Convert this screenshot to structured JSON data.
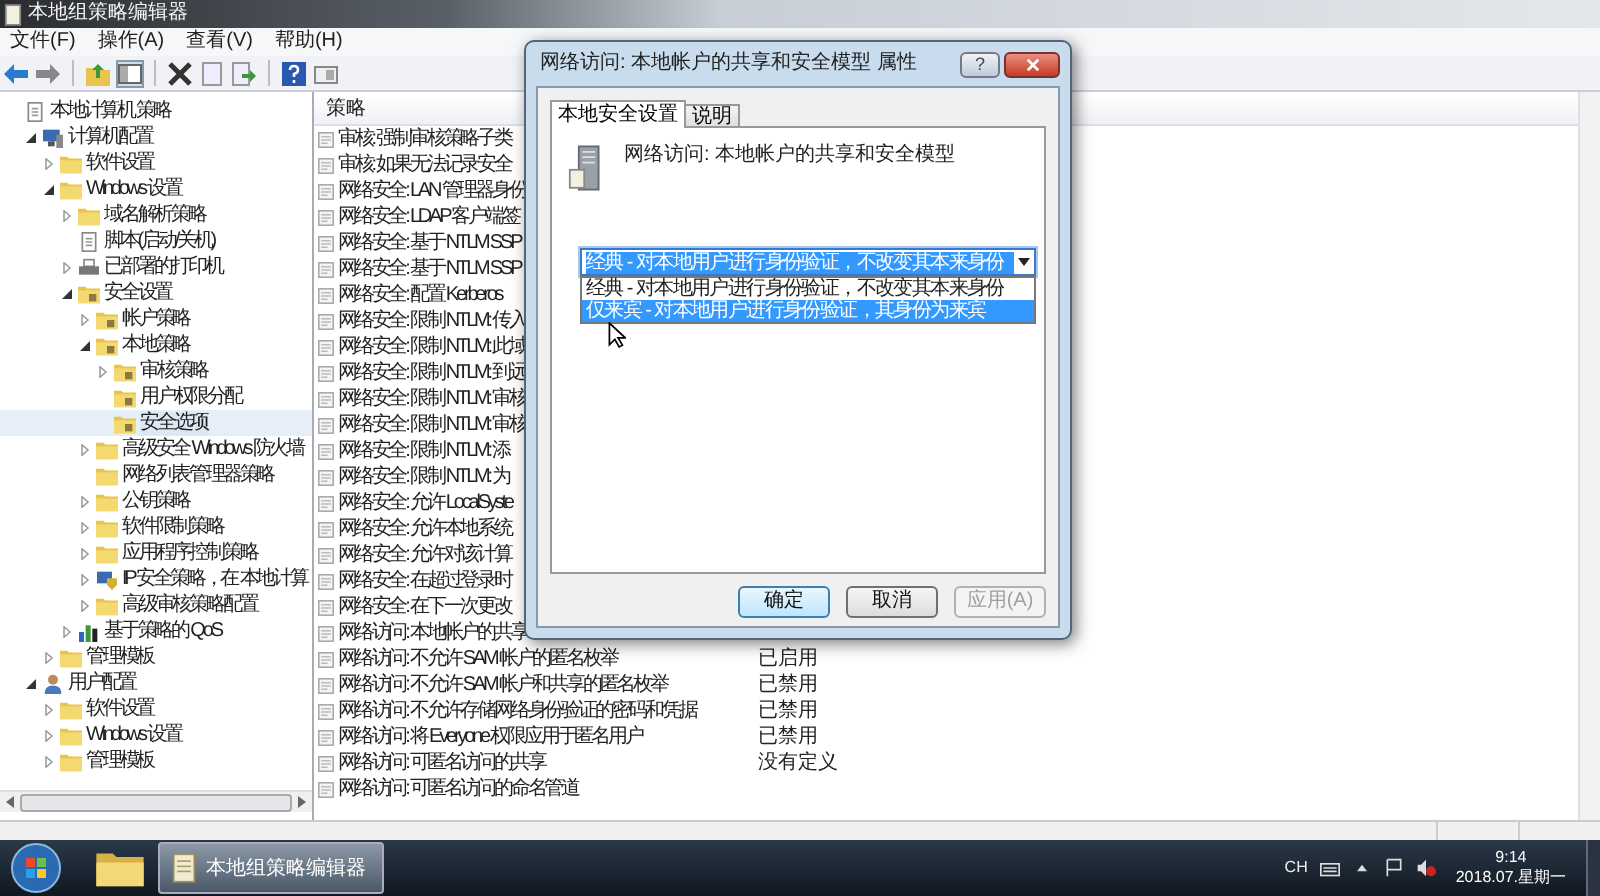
{
  "window": {
    "title": "本地组策略编辑器"
  },
  "menu": [
    "文件(F)",
    "操作(A)",
    "查看(V)",
    "帮助(H)"
  ],
  "tree": [
    {
      "label": "本地计算机 策略",
      "kind": "document",
      "selected": false,
      "children": [
        {
          "label": "计算机配置",
          "kind": "computer",
          "expanded": true,
          "selected": false,
          "children": [
            {
              "label": "软件设置",
              "kind": "folder",
              "expanded": false,
              "selected": false
            },
            {
              "label": "Windows 设置",
              "kind": "folder",
              "expanded": true,
              "selected": false,
              "children": [
                {
                  "label": "域名解析策略",
                  "kind": "folder",
                  "expanded": false,
                  "selected": false
                },
                {
                  "label": "脚本(启动/关机)",
                  "kind": "document",
                  "selected": false
                },
                {
                  "label": "已部署的打印机",
                  "kind": "printer",
                  "expanded": false,
                  "selected": false
                },
                {
                  "label": "安全设置",
                  "kind": "secure-folder",
                  "expanded": true,
                  "selected": false,
                  "children": [
                    {
                      "label": "帐户策略",
                      "kind": "secure-folder",
                      "expanded": false,
                      "selected": false
                    },
                    {
                      "label": "本地策略",
                      "kind": "secure-folder",
                      "expanded": true,
                      "selected": false,
                      "children": [
                        {
                          "label": "审核策略",
                          "kind": "secure-folder",
                          "expanded": false,
                          "selected": false
                        },
                        {
                          "label": "用户权限分配",
                          "kind": "secure-folder",
                          "selected": false
                        },
                        {
                          "label": "安全选项",
                          "kind": "secure-folder",
                          "selected": true
                        }
                      ]
                    },
                    {
                      "label": "高级安全 Windows 防火墙",
                      "kind": "folder",
                      "expanded": false,
                      "selected": false
                    },
                    {
                      "label": "网络列表管理器策略",
                      "kind": "folder",
                      "selected": false
                    },
                    {
                      "label": "公钥策略",
                      "kind": "folder",
                      "expanded": false,
                      "selected": false
                    },
                    {
                      "label": "软件限制策略",
                      "kind": "folder",
                      "expanded": false,
                      "selected": false
                    },
                    {
                      "label": "应用程序控制策略",
                      "kind": "folder",
                      "expanded": false,
                      "selected": false
                    },
                    {
                      "label": "IP 安全策略，在 本地计算",
                      "kind": "shield",
                      "expanded": false,
                      "selected": false
                    },
                    {
                      "label": "高级审核策略配置",
                      "kind": "folder",
                      "expanded": false,
                      "selected": false
                    }
                  ]
                },
                {
                  "label": "基于策略的 QoS",
                  "kind": "chart",
                  "expanded": false,
                  "selected": false
                }
              ]
            },
            {
              "label": "管理模板",
              "kind": "folder",
              "expanded": false,
              "selected": false
            }
          ]
        },
        {
          "label": "用户配置",
          "kind": "user",
          "expanded": true,
          "selected": false,
          "children": [
            {
              "label": "软件设置",
              "kind": "folder",
              "expanded": false,
              "selected": false
            },
            {
              "label": "Windows 设置",
              "kind": "folder",
              "expanded": false,
              "selected": false
            },
            {
              "label": "管理模板",
              "kind": "folder",
              "expanded": false,
              "selected": false
            }
          ]
        }
      ]
    }
  ],
  "policy_list": {
    "column_1": "策略",
    "rows": [
      {
        "name": "审核: 强制审核策略子类"
      },
      {
        "name": "审核: 如果无法记录安全"
      },
      {
        "name": "网络安全: LAN 管理器身份"
      },
      {
        "name": "网络安全: LDAP 客户端签"
      },
      {
        "name": "网络安全: 基于 NTLM SSP"
      },
      {
        "name": "网络安全: 基于 NTLM SSP"
      },
      {
        "name": "网络安全: 配置 Kerberos"
      },
      {
        "name": "网络安全: 限制 NTLM: 传入"
      },
      {
        "name": "网络安全: 限制 NTLM: 此域"
      },
      {
        "name": "网络安全: 限制 NTLM: 到远"
      },
      {
        "name": "网络安全: 限制 NTLM: 审核"
      },
      {
        "name": "网络安全: 限制 NTLM: 审核"
      },
      {
        "name": "网络安全: 限制 NTLM: 添"
      },
      {
        "name": "网络安全: 限制 NTLM: 为"
      },
      {
        "name": "网络安全: 允许 LocalSyste"
      },
      {
        "name": "网络安全: 允许本地系统"
      },
      {
        "name": "网络安全: 允许对该计算"
      },
      {
        "name": "网络安全: 在超过登录时"
      },
      {
        "name": "网络安全: 在下一次更改"
      },
      {
        "name": "网络访问: 本地帐户的共享"
      },
      {
        "name": "网络访问: 不允许 SAM 帐户的匿名枚举",
        "setting": "已启用"
      },
      {
        "name": "网络访问: 不允许 SAM 帐户和共享的匿名枚举",
        "setting": "已禁用"
      },
      {
        "name": "网络访问: 不允许存储网络身份验证的密码和凭据",
        "setting": "已禁用"
      },
      {
        "name": "网络访问: 将 Everyone 权限应用于匿名用户",
        "setting": "已禁用"
      },
      {
        "name": "网络访问: 可匿名访问的共享",
        "setting": "没有定义"
      },
      {
        "name": "网络访问: 可匿名访问的命名管道"
      }
    ]
  },
  "dialog": {
    "title": "网络访问: 本地帐户的共享和安全模型 属性",
    "help": "?",
    "tabs": [
      {
        "label": "本地安全设置",
        "selected": true
      },
      {
        "label": "说明",
        "selected": false
      }
    ],
    "heading": "网络访问: 本地帐户的共享和安全模型",
    "combo": {
      "value": "经典 - 对本地用户进行身份验证，不改变其本来身份",
      "expanded": true,
      "options": [
        {
          "label": "经典 - 对本地用户进行身份验证，不改变其本来身份",
          "highlighted": false
        },
        {
          "label": "仅来宾 - 对本地用户进行身份验证，其身份为来宾",
          "highlighted": true
        }
      ]
    },
    "buttons": [
      {
        "label": "确定",
        "disabled": false
      },
      {
        "label": "取消",
        "disabled": false
      },
      {
        "label": "应用(A)",
        "disabled": true
      }
    ]
  },
  "taskbar": {
    "tasks": [
      {
        "label": "本地组策略编辑器",
        "selected": true
      }
    ],
    "language": "CH",
    "time": "9:14",
    "date": "2018.07.星期一"
  }
}
